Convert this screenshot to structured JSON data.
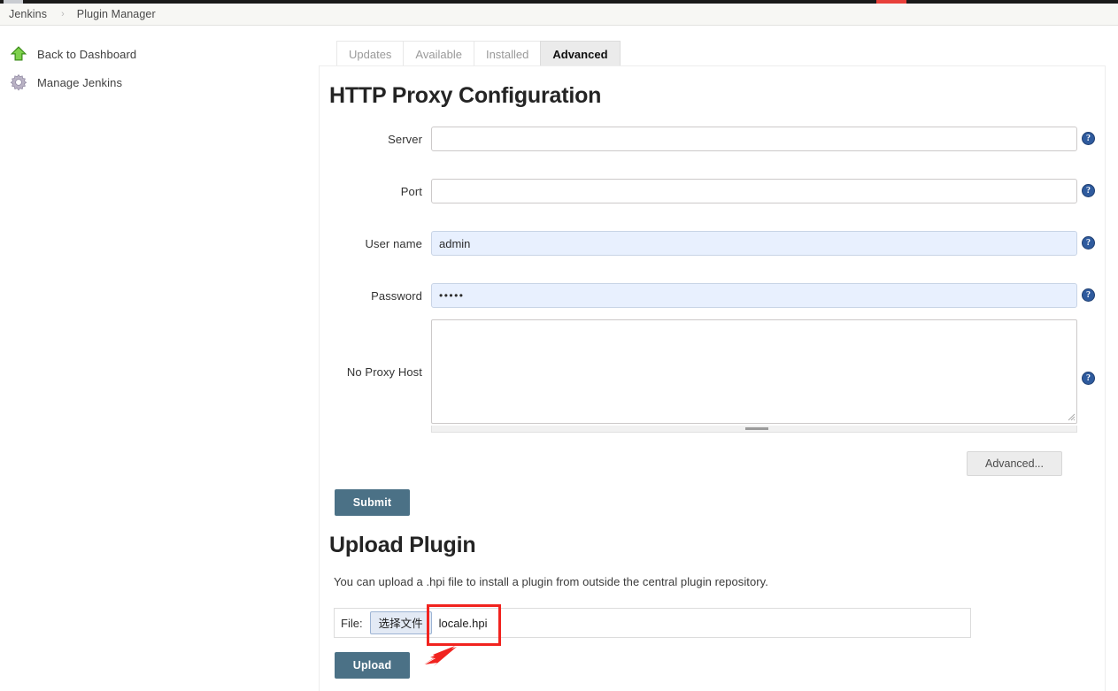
{
  "breadcrumb": {
    "root": "Jenkins",
    "separator": "›",
    "current": "Plugin Manager"
  },
  "sidebar": {
    "items": [
      {
        "label": "Back to Dashboard",
        "icon": "up-arrow-icon"
      },
      {
        "label": "Manage Jenkins",
        "icon": "gear-icon"
      }
    ]
  },
  "tabs": [
    {
      "label": "Updates",
      "active": false
    },
    {
      "label": "Available",
      "active": false
    },
    {
      "label": "Installed",
      "active": false
    },
    {
      "label": "Advanced",
      "active": true
    }
  ],
  "proxy_section": {
    "title": "HTTP Proxy Configuration",
    "fields": [
      {
        "label": "Server",
        "value": "",
        "placeholder": "",
        "help": "?"
      },
      {
        "label": "Port",
        "value": "",
        "placeholder": "",
        "help": "?"
      },
      {
        "label": "User name",
        "value": "admin",
        "placeholder": "",
        "help": "?"
      },
      {
        "label": "Password",
        "value": "•••••",
        "placeholder": "",
        "help": "?"
      },
      {
        "label": "No Proxy Host",
        "value": "",
        "placeholder": "",
        "help": "?"
      }
    ],
    "advanced_button": "Advanced...",
    "submit_button": "Submit"
  },
  "upload_section": {
    "title": "Upload Plugin",
    "description": "You can upload a .hpi file to install a plugin from outside the central plugin repository.",
    "file_label": "File:",
    "choose_file_button": "选择文件",
    "file_name": "locale.hpi",
    "upload_button": "Upload"
  },
  "colors": {
    "primary_button": "#4b7186",
    "help_icon": "#2f5b9e",
    "annotation": "#f1231f",
    "autofill_field": "#e8f0fe",
    "active_tab": "#ebebeb"
  }
}
